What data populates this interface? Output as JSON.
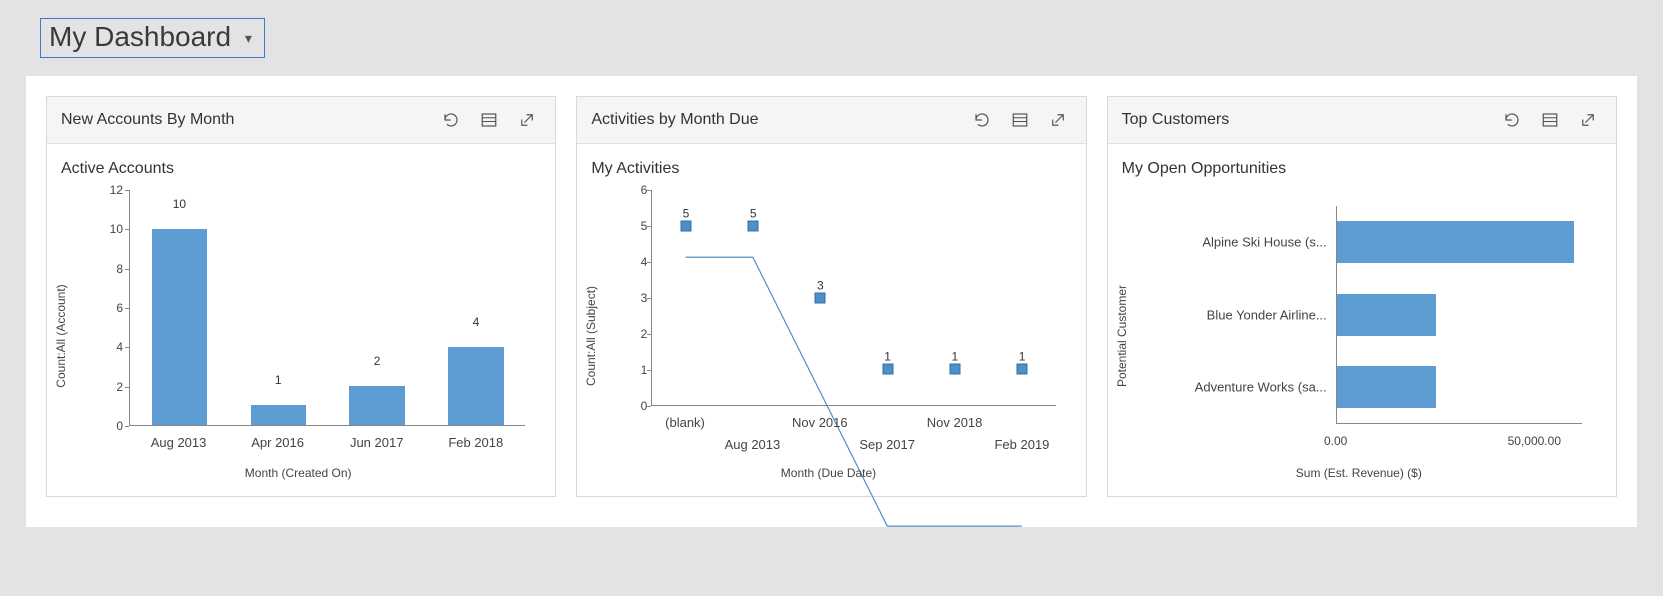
{
  "dashboard": {
    "title": "My Dashboard"
  },
  "cards": [
    {
      "title": "New Accounts By Month",
      "subtitle": "Active Accounts"
    },
    {
      "title": "Activities by Month Due",
      "subtitle": "My Activities"
    },
    {
      "title": "Top Customers",
      "subtitle": "My Open Opportunities"
    }
  ],
  "chart_data": [
    {
      "type": "bar",
      "orientation": "vertical",
      "title": "New Accounts By Month",
      "subtitle": "Active Accounts",
      "categories": [
        "Aug 2013",
        "Apr 2016",
        "Jun 2017",
        "Feb 2018"
      ],
      "values": [
        10,
        1,
        2,
        4
      ],
      "xlabel": "Month (Created On)",
      "ylabel": "Count:All (Account)",
      "yticks": [
        0,
        2,
        4,
        6,
        8,
        10,
        12
      ],
      "ylim": [
        0,
        12
      ],
      "show_data_labels": true
    },
    {
      "type": "line",
      "title": "Activities by Month Due",
      "subtitle": "My Activities",
      "points": [
        {
          "label": "(blank)",
          "value": 5
        },
        {
          "label": "Aug 2013",
          "value": 5
        },
        {
          "label": "Nov 2016",
          "value": 3
        },
        {
          "label": "Sep 2017",
          "value": 1
        },
        {
          "label": "Nov 2018",
          "value": 1
        },
        {
          "label": "Feb 2019",
          "value": 1
        }
      ],
      "category_tick_rows": [
        [
          "(blank)",
          "Nov 2016",
          "Nov 2018"
        ],
        [
          "Aug 2013",
          "Sep 2017",
          "Feb 2019"
        ]
      ],
      "xlabel": "Month (Due Date)",
      "ylabel": "Count:All (Subject)",
      "yticks": [
        0,
        1,
        2,
        3,
        4,
        5,
        6
      ],
      "ylim": [
        0,
        6
      ],
      "show_data_labels": true
    },
    {
      "type": "bar",
      "orientation": "horizontal",
      "title": "Top Customers",
      "subtitle": "My Open Opportunities",
      "categories": [
        "Alpine Ski House (s...",
        "Blue Yonder Airline...",
        "Adventure Works (sa..."
      ],
      "values": [
        60000,
        25000,
        25000
      ],
      "xlabel": "Sum (Est. Revenue) ($)",
      "ylabel": "Potential Customer",
      "xticks": [
        0,
        50000
      ],
      "xtick_labels": [
        "0.00",
        "50,000.00"
      ],
      "xlim": [
        0,
        62000
      ]
    }
  ]
}
